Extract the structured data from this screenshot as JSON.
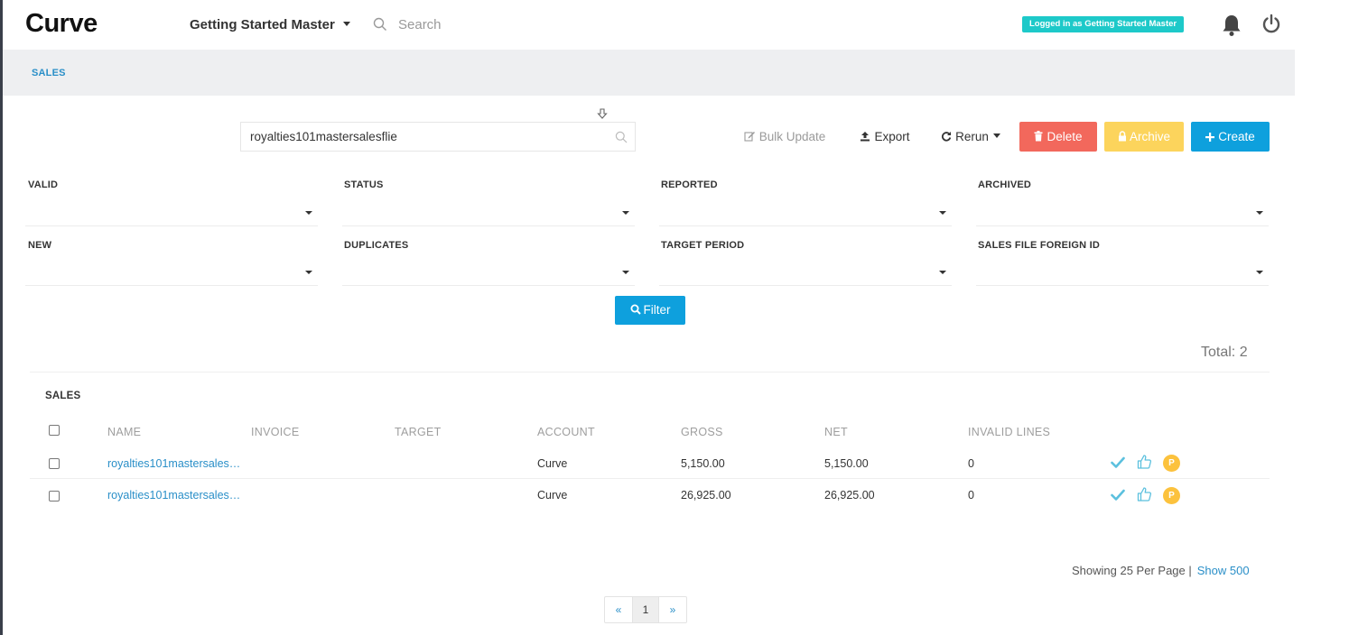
{
  "app": {
    "logo": "Curve",
    "account_switcher": "Getting Started Master",
    "search_placeholder": "Search",
    "login_status": "Logged in as Getting Started Master"
  },
  "breadcrumb": {
    "current": "SALES"
  },
  "file_search": {
    "value": "royalties101mastersalesflie"
  },
  "actions": {
    "bulk_update": "Bulk Update",
    "export": "Export",
    "rerun": "Rerun",
    "delete": "Delete",
    "archive": "Archive",
    "create": "Create"
  },
  "filters": {
    "valid": "VALID",
    "status": "STATUS",
    "reported": "REPORTED",
    "archived": "ARCHIVED",
    "new": "NEW",
    "duplicates": "DUPLICATES",
    "target_period": "TARGET PERIOD",
    "sales_file_foreign_id": "SALES FILE FOREIGN ID",
    "filter_button": "Filter"
  },
  "total": "Total: 2",
  "table": {
    "title": "SALES",
    "columns": [
      "NAME",
      "INVOICE",
      "TARGET",
      "ACCOUNT",
      "GROSS",
      "NET",
      "INVALID LINES"
    ],
    "rows": [
      {
        "name": "royalties101mastersales…",
        "invoice": "",
        "target": "",
        "account": "Curve",
        "gross": "5,150.00",
        "net": "5,150.00",
        "invalid_lines": "0",
        "badge": "P"
      },
      {
        "name": "royalties101mastersales…",
        "invoice": "",
        "target": "",
        "account": "Curve",
        "gross": "26,925.00",
        "net": "26,925.00",
        "invalid_lines": "0",
        "badge": "P"
      }
    ]
  },
  "paging": {
    "per_page": "Showing 25 Per Page |",
    "show_more": "Show 500",
    "prev": "«",
    "current": "1",
    "next": "»"
  },
  "colors": {
    "accent": "#0ea0dd",
    "delete": "#f2685c",
    "archive": "#fcd45c",
    "badge": "#1dc9c9",
    "link": "#2a8fc8"
  }
}
